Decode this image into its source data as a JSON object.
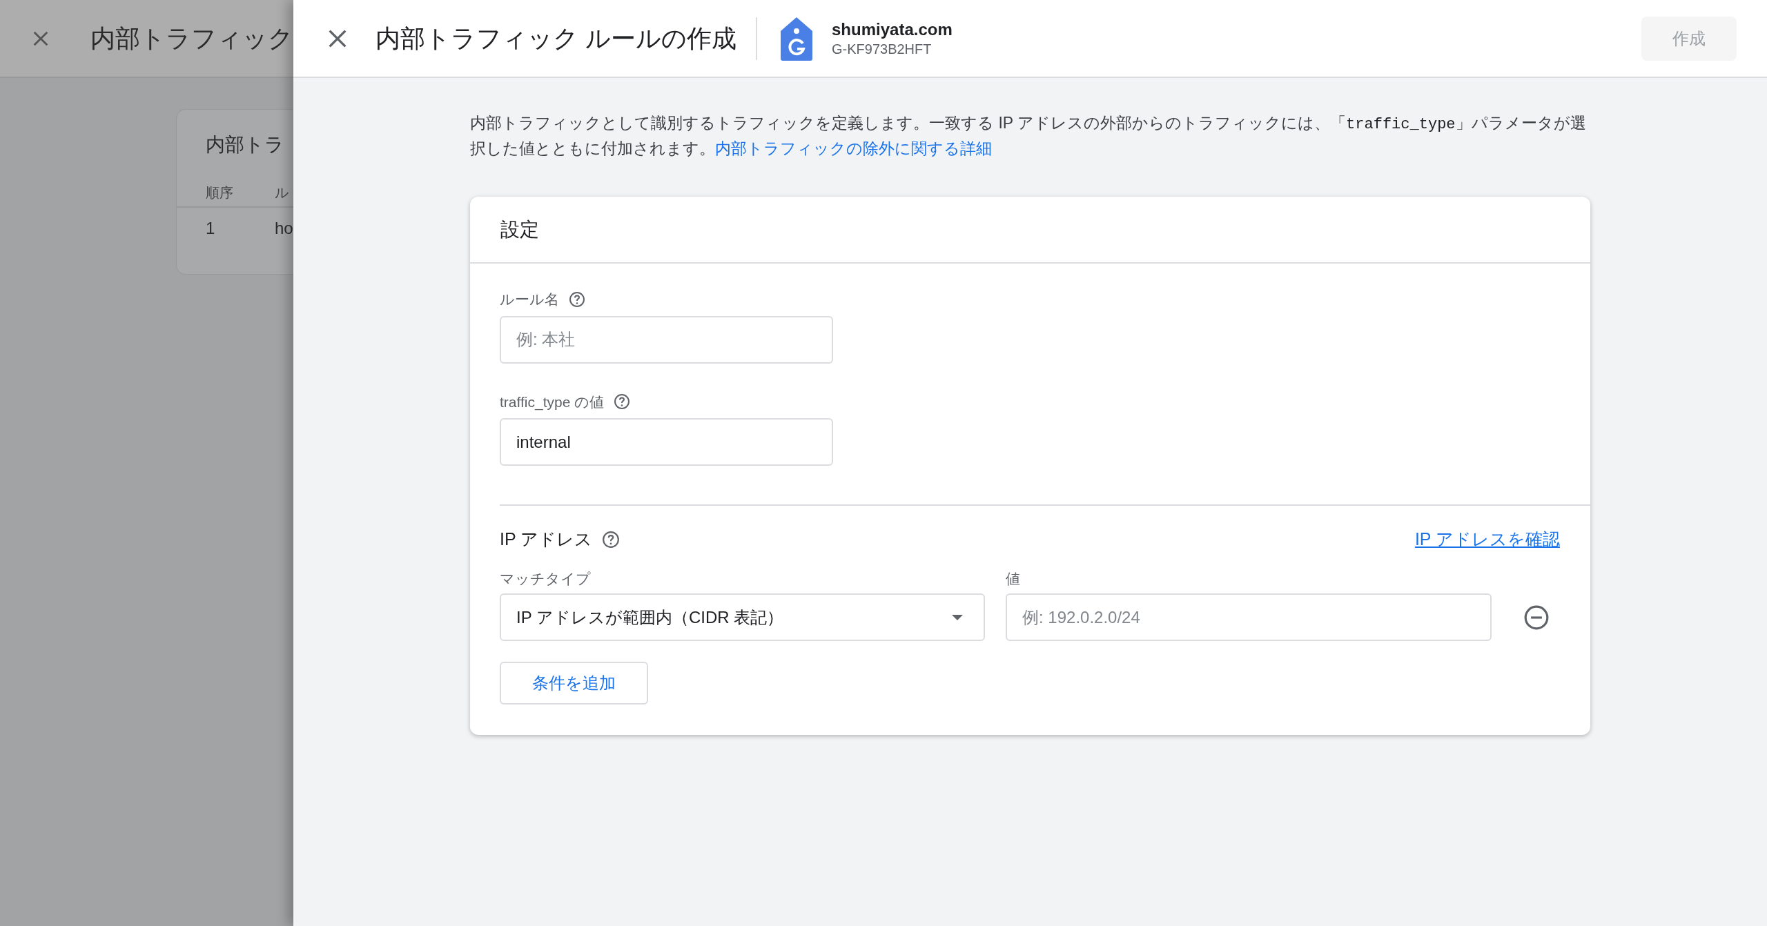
{
  "background_page": {
    "title": "内部トラフィック",
    "card": {
      "title": "内部トラ",
      "columns": [
        "順序",
        "ル"
      ],
      "rows": [
        [
          "1",
          "ho"
        ]
      ]
    }
  },
  "drawer": {
    "title": "内部トラフィック ルールの作成",
    "property": {
      "name": "shumiyata.com",
      "id": "G-KF973B2HFT"
    },
    "create_button": {
      "label": "作成",
      "disabled": true
    }
  },
  "description": {
    "before": "内部トラフィックとして識別するトラフィックを定義します。一致する IP アドレスの外部からのトラフィックには、「",
    "code": "traffic_type",
    "after": "」パラメータが選択した値とともに付加されます。",
    "link": "内部トラフィックの除外に関する詳細"
  },
  "settings": {
    "title": "設定",
    "fields": [
      {
        "label": "ルール名",
        "placeholder": "例: 本社"
      },
      {
        "label": "traffic_type の値",
        "value": "internal"
      }
    ],
    "ip_section": {
      "title": "IP アドレス",
      "link": "IP アドレスを確認",
      "match_type_label": "マッチタイプ",
      "value_label": "値",
      "conditions": [
        {
          "match_type": "IP アドレスが範囲内（CIDR 表記）",
          "placeholder": "例: 192.0.2.0/24"
        }
      ],
      "add_button": "条件を追加"
    }
  }
}
